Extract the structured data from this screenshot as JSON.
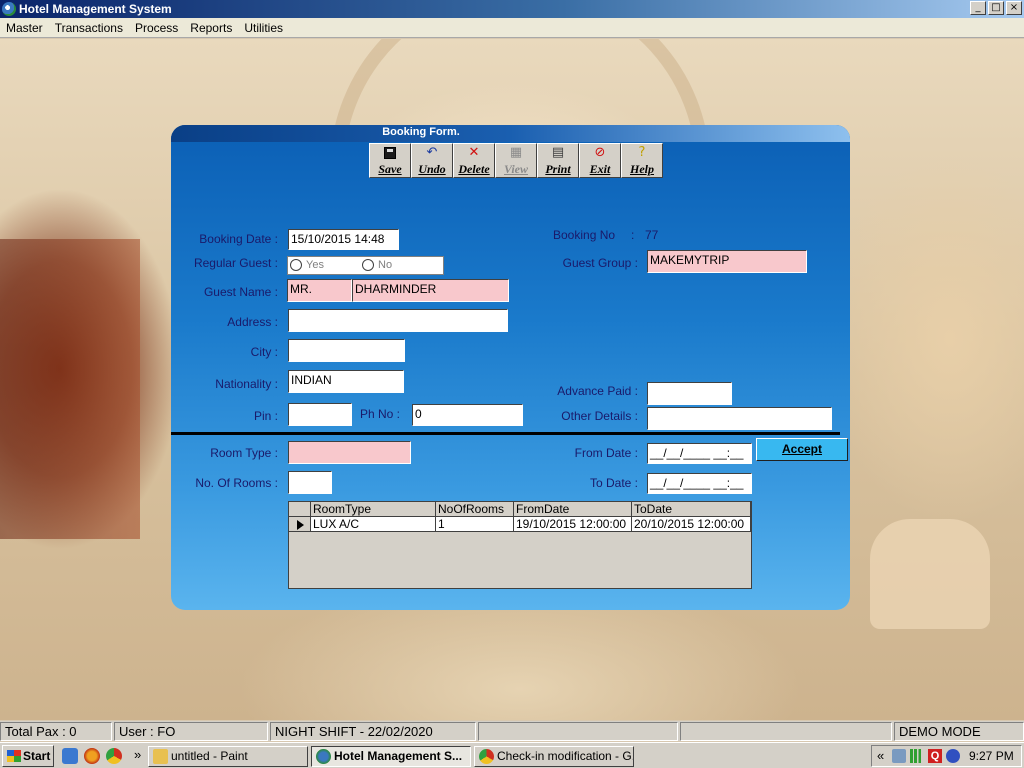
{
  "window": {
    "title": "Hotel Management System",
    "controls": [
      "_",
      "□",
      "×"
    ]
  },
  "menu": [
    "Master",
    "Transactions",
    "Process",
    "Reports",
    "Utilities"
  ],
  "form": {
    "title": "Booking Form.",
    "toolbar": [
      {
        "label": "Save",
        "icon": "save-icon",
        "enabled": true
      },
      {
        "label": "Undo",
        "icon": "undo-icon",
        "enabled": true
      },
      {
        "label": "Delete",
        "icon": "delete-icon",
        "enabled": true
      },
      {
        "label": "View",
        "icon": "view-icon",
        "enabled": false
      },
      {
        "label": "Print",
        "icon": "print-icon",
        "enabled": true
      },
      {
        "label": "Exit",
        "icon": "exit-icon",
        "enabled": true
      },
      {
        "label": "Help",
        "icon": "help-icon",
        "enabled": true
      }
    ],
    "booking_date": {
      "label": "Booking Date :",
      "value": "15/10/2015 14:48"
    },
    "booking_no": {
      "label": "Booking No",
      "separator": ":",
      "value": "77"
    },
    "regular_guest": {
      "label": "Regular Guest :",
      "yes": "Yes",
      "no": "No"
    },
    "guest_group": {
      "label": "Guest Group :",
      "value": "MAKEMYTRIP"
    },
    "guest_name": {
      "label": "Guest Name :",
      "salutation": "MR.",
      "value": "DHARMINDER"
    },
    "address": {
      "label": "Address :",
      "value": ""
    },
    "city": {
      "label": "City :",
      "value": ""
    },
    "nationality": {
      "label": "Nationality :",
      "value": "INDIAN"
    },
    "advance_paid": {
      "label": "Advance Paid :",
      "value": ""
    },
    "pin": {
      "label": "Pin :",
      "value": ""
    },
    "ph_no": {
      "label": "Ph No :",
      "value": "0"
    },
    "other_details": {
      "label": "Other Details :",
      "value": ""
    },
    "room_type": {
      "label": "Room Type :",
      "value": ""
    },
    "no_of_rooms": {
      "label": "No. Of Rooms :",
      "value": ""
    },
    "from_date": {
      "label": "From Date :",
      "value": "__/__/____ __:__"
    },
    "to_date": {
      "label": "To Date :",
      "value": "__/__/____ __:__"
    },
    "accept_label": "Accept",
    "grid": {
      "columns": [
        "RoomType",
        "NoOfRooms",
        "FromDate",
        "ToDate"
      ],
      "rows": [
        [
          "LUX A/C",
          "1",
          "19/10/2015 12:00:00",
          "20/10/2015 12:00:00"
        ]
      ]
    }
  },
  "status": {
    "total_pax": "Total Pax : 0",
    "user": "User : FO",
    "shift": "NIGHT SHIFT - 22/02/2020",
    "mode": "DEMO MODE"
  },
  "taskbar": {
    "start": "Start",
    "more": "»",
    "tasks": [
      "untitled - Paint",
      "Hotel Management S...",
      "Check-in modification - G..."
    ],
    "tray_expand": "«",
    "clock": "9:27 PM"
  }
}
